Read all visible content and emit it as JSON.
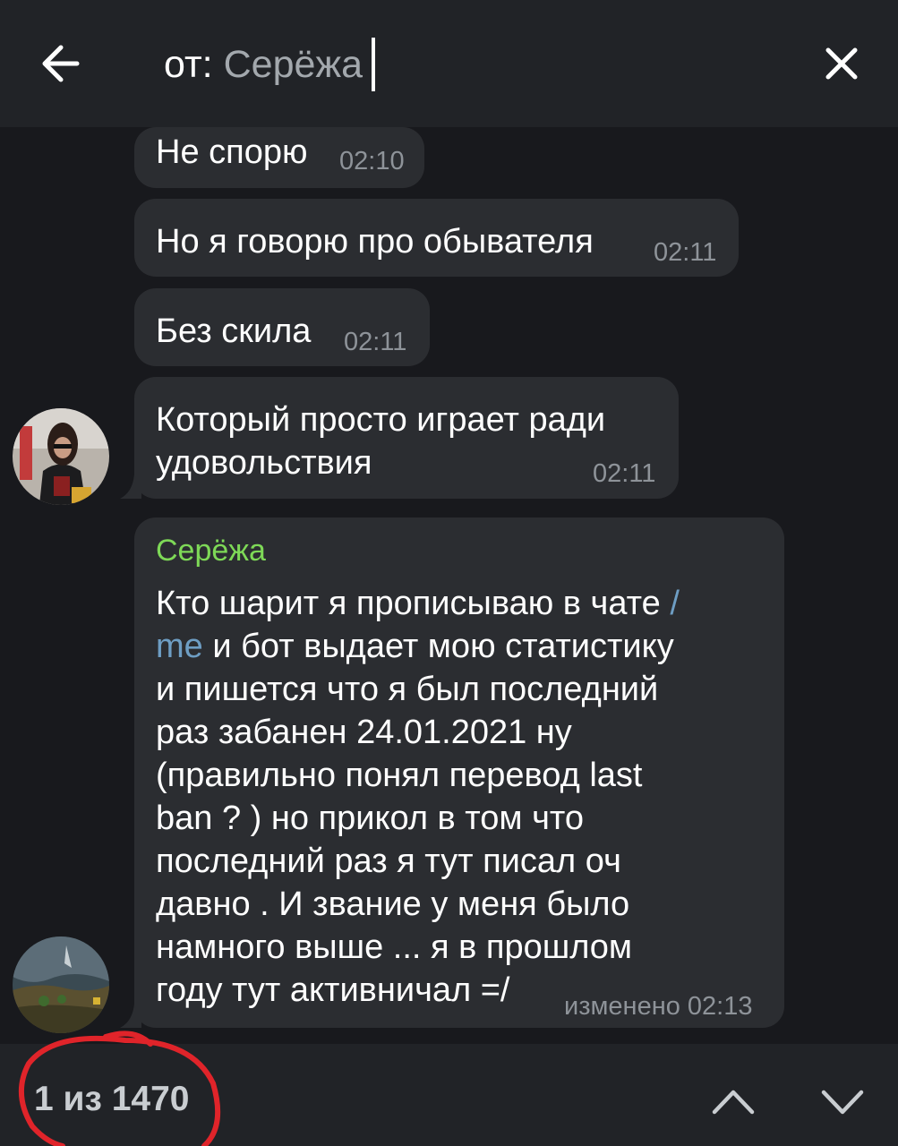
{
  "search": {
    "prefix": "от:",
    "value": "Серёжа"
  },
  "messages": [
    {
      "text": "Не спорю",
      "time": "02:10"
    },
    {
      "text": "Но я говорю про обывателя",
      "time": "02:11"
    },
    {
      "text": "Без скила",
      "time": "02:11"
    },
    {
      "text_line1": "Который просто играет ради",
      "text_line2": "удовольствия",
      "time": "02:11"
    },
    {
      "sender": "Серёжа",
      "lines": [
        "Кто шарит я прописываю в чате ",
        "/",
        "me",
        " и бот выдает мою статистику",
        "и пишется что я был последний",
        "раз забанен 24.01.2021 ну",
        "(правильно понял перевод last",
        "ban ? ) но прикол в том что",
        "последний раз я тут писал оч",
        "давно . И звание у меня было",
        "намного выше ... я в прошлом",
        "году тут активничал =/"
      ],
      "edited_label": "изменено",
      "time": "02:13"
    }
  ],
  "bottom": {
    "counter": "1 из 1470"
  },
  "colors": {
    "background": "#18191d",
    "bubble": "#2b2d31",
    "bar": "#212327",
    "sender_name": "#7ed957",
    "link": "#6e9ec4",
    "annotation": "#e0242a"
  }
}
